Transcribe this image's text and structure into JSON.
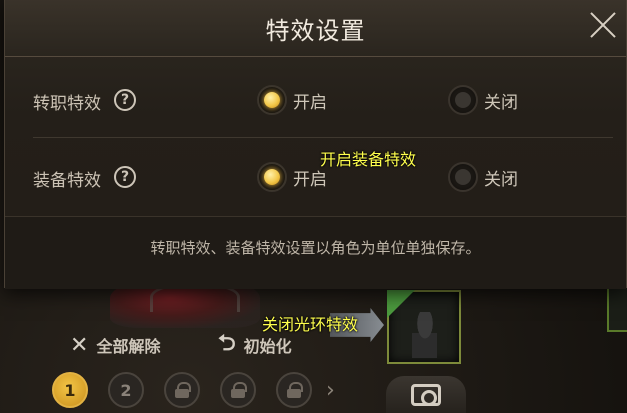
{
  "dialog": {
    "title": "特效设置",
    "rows": [
      {
        "label": "转职特效",
        "help": "?",
        "options": [
          {
            "label": "开启",
            "selected": true
          },
          {
            "label": "关闭",
            "selected": false
          }
        ]
      },
      {
        "label": "装备特效",
        "help": "?",
        "options": [
          {
            "label": "开启",
            "selected": true
          },
          {
            "label": "关闭",
            "selected": false
          }
        ]
      }
    ],
    "footer_note": "转职特效、装备特效设置以角色为单位单独保存。"
  },
  "background": {
    "reset_all_label": "全部解除",
    "initialize_label": "初始化",
    "pages": [
      "1",
      "2"
    ],
    "active_page": "1",
    "locked_icon": "lock-icon",
    "camera_icon": "camera-icon"
  },
  "tooltips": {
    "equip_effect_on": "开启装备特效",
    "aura_off": "关闭光环特效"
  },
  "colors": {
    "selected_radio": "#f3c84a",
    "tooltip_text": "#ffff4d",
    "dialog_bg": "#241f19"
  }
}
